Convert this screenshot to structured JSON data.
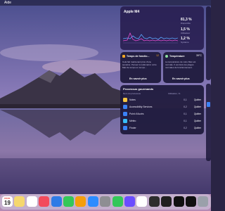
{
  "menubar": {
    "items": [
      "Aide"
    ]
  },
  "cpu_widget": {
    "chip": "Apple M4",
    "stats": [
      {
        "value": "81,3 %",
        "label": "Disponible"
      },
      {
        "value": "1,5 %",
        "label": "Utilisateur"
      },
      {
        "value": "1,2 %",
        "label": "Système"
      }
    ],
    "colors": {
      "user": "#e64fd1",
      "system": "#5aa7ff"
    }
  },
  "fan_widget": {
    "title": "Temps de fonctio...",
    "badge": "12",
    "body": "Cela fait maintenant plus d'une semaine. Pensez à redémarrer votre Mac de temps en temps...",
    "link": "En savoir plus"
  },
  "temp_widget": {
    "title": "Température",
    "value": "39°C",
    "body": "La température de votre Mac est normale. Il est dans les plages normales de fonctionnement.",
    "link": "En savoir plus"
  },
  "processes": {
    "title": "Processus gourmands",
    "col_name": "Nom du processus",
    "col_usage": "Utilisation, %",
    "rows": [
      {
        "name": "Notes",
        "usage": "0,1",
        "quit": "Quitter",
        "icon": "notes-icon",
        "color": "#f5c542"
      },
      {
        "name": "Accessibility Services",
        "usage": "0,2",
        "quit": "Quitter",
        "icon": "accessibility-icon",
        "color": "#3b82f6"
      },
      {
        "name": "Point d'Accès",
        "usage": "0,1",
        "quit": "Quitter",
        "icon": "hotspot-icon",
        "color": "#3b82f6"
      },
      {
        "name": "Météo",
        "usage": "0,1",
        "quit": "Quitter",
        "icon": "weather-icon",
        "color": "#38bdf8"
      },
      {
        "name": "Finder",
        "usage": "0,2",
        "quit": "Quitter",
        "icon": "finder-icon",
        "color": "#3b82f6"
      }
    ]
  },
  "dock": {
    "calendar_month": "FÉVR.",
    "calendar_day": "19",
    "apps": [
      {
        "name": "calendar-app-icon",
        "color": "#ffffff"
      },
      {
        "name": "notes-app-icon",
        "color": "#f5d76e"
      },
      {
        "name": "reminders-app-icon",
        "color": "#ffffff"
      },
      {
        "name": "music-app-icon",
        "color": "#f24b5b"
      },
      {
        "name": "keynote-app-icon",
        "color": "#2f7be6"
      },
      {
        "name": "numbers-app-icon",
        "color": "#34c759"
      },
      {
        "name": "pages-app-icon",
        "color": "#f59e0b"
      },
      {
        "name": "app-store-icon",
        "color": "#2b8cff"
      },
      {
        "name": "system-settings-icon",
        "color": "#8e8e93"
      },
      {
        "name": "icloud-icon",
        "color": "#34c759"
      },
      {
        "name": "shortcuts-app-icon",
        "color": "#6a4dff"
      },
      {
        "name": "photos-app-icon",
        "color": "#ffffff"
      },
      {
        "name": "terminal-app-icon",
        "color": "#2d2d2d"
      },
      {
        "name": "activity-monitor-icon",
        "color": "#1f1f1f"
      },
      {
        "name": "chatgpt-app-icon",
        "color": "#111111"
      },
      {
        "name": "openai-app-icon",
        "color": "#111111"
      },
      {
        "name": "trash-icon",
        "color": "#9aa0aa"
      }
    ]
  }
}
